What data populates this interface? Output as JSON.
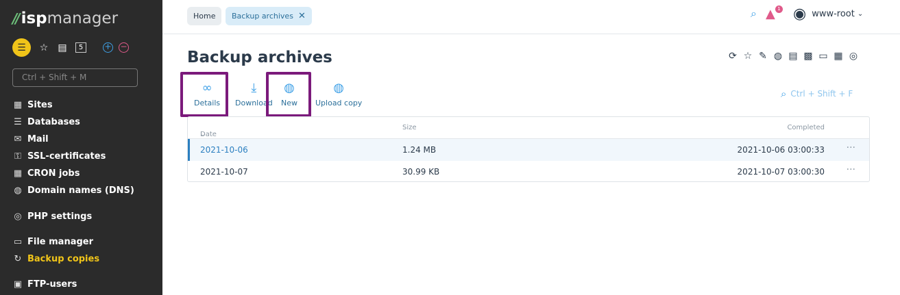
{
  "app": {
    "logo_mark": "//",
    "logo_isp": "isp",
    "logo_manager": "manager"
  },
  "sidebar": {
    "search_placeholder": "Ctrl + Shift + M",
    "quick_box": "5",
    "items": [
      {
        "label": "Sites",
        "icon": "sites-icon"
      },
      {
        "label": "Databases",
        "icon": "database-icon"
      },
      {
        "label": "Mail",
        "icon": "mail-icon"
      },
      {
        "label": "SSL-certificates",
        "icon": "lock-icon"
      },
      {
        "label": "CRON jobs",
        "icon": "calendar-icon"
      },
      {
        "label": "Domain names (DNS)",
        "icon": "globe-icon"
      },
      {
        "label": "PHP settings",
        "icon": "php-icon"
      },
      {
        "label": "File manager",
        "icon": "folder-icon"
      },
      {
        "label": "Backup copies",
        "icon": "backup-icon",
        "active": true
      },
      {
        "label": "FTP-users",
        "icon": "ftp-icon"
      }
    ]
  },
  "topbar": {
    "breadcrumbs": [
      "Home",
      "Backup archives"
    ],
    "alert_count": "1",
    "user": "www-root"
  },
  "page": {
    "title": "Backup archives"
  },
  "toolbar": {
    "details": "Details",
    "download": "Download",
    "new": "New",
    "upload_copy": "Upload copy",
    "search_placeholder": "Ctrl + Shift + F"
  },
  "table": {
    "columns": [
      "Date",
      "Size",
      "Completed"
    ],
    "rows": [
      {
        "date": "2021-10-06",
        "size": "1.24 MB",
        "completed": "2021-10-06 03:00:33"
      },
      {
        "date": "2021-10-07",
        "size": "30.99 KB",
        "completed": "2021-10-07 03:00:30"
      }
    ]
  },
  "colors": {
    "accent": "#3ea0e6",
    "sidebar_bg": "#2b2b2b",
    "active": "#f0c419",
    "highlight": "#7b1a7b"
  }
}
